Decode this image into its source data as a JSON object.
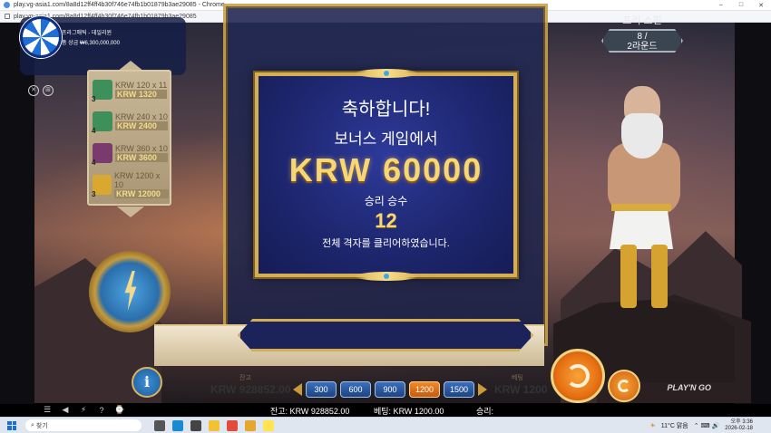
{
  "browser": {
    "title": "play.vg-asia1.com/8a8d12ff4ff4b30f746e74fb1b01879b3ae29085 - Chrome",
    "url": "play.vg-asia1.com/8a8d12ff4ff4b30f746e74fb1b01879b3ae29085",
    "controls": [
      "–",
      "□",
      "✕"
    ]
  },
  "promo": {
    "line1": "프라그매틱 - 데일리윈",
    "line2": "총 상금 ₩6,300,000,000"
  },
  "paytable": [
    {
      "count": "3",
      "line1": "KRW 120 x 11",
      "line2": "KRW 1320",
      "color": "#3f8f5a"
    },
    {
      "count": "4",
      "line1": "KRW 240 x 10",
      "line2": "KRW 2400",
      "color": "#3f8f5a"
    },
    {
      "count": "4",
      "line1": "KRW 360 x 10",
      "line2": "KRW 3600",
      "color": "#7a3a6e"
    },
    {
      "count": "3",
      "line1": "KRW 1200 x 10",
      "line2": "KRW 12000",
      "color": "#d9a82e"
    }
  ],
  "free_spins": {
    "label": "프리 스핀",
    "value": "8 /",
    "rounds": "2라운드"
  },
  "popup": {
    "congrats": "축하합니다!",
    "bonus_line": "보너스 게임에서",
    "amount": "KRW 60000",
    "win_label": "승리 승수",
    "win_count": "12",
    "clear_text": "전체 격자를 클리어하였습니다."
  },
  "controls": {
    "info": "i",
    "balance_label": "잔고",
    "balance": "KRW 928852.00",
    "bet_label": "베팅",
    "bet": "KRW 1200",
    "bet_options": [
      "300",
      "600",
      "900",
      "1200",
      "1500"
    ],
    "selected_bet": "1200",
    "brand": "PLAY'N GO"
  },
  "status": {
    "balance": "잔고: KRW 928852.00",
    "bet": "베팅: KRW 1200.00",
    "win": "승리:"
  },
  "taskbar": {
    "search": "찾기",
    "weather": "11°C 맑음",
    "time": "오후 3:36",
    "date": "2026-02-18"
  }
}
